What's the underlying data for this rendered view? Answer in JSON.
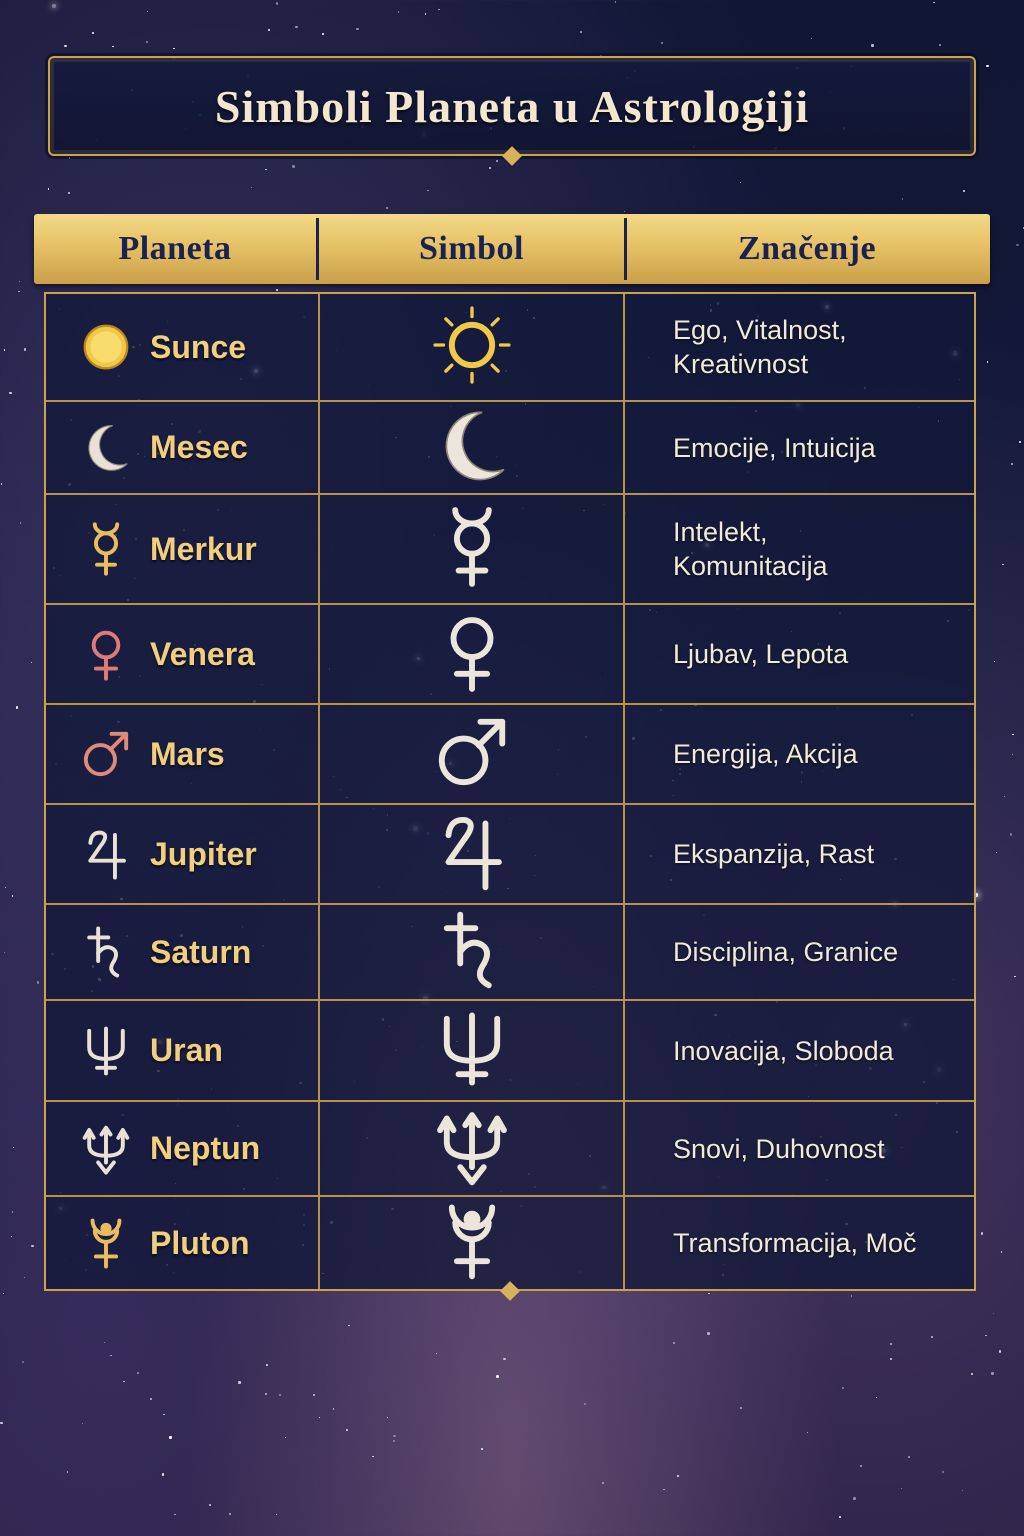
{
  "title": "Simboli Planeta u Astrologiji",
  "headers": [
    "Planeta",
    "Simbol",
    "Značenje"
  ],
  "rows": [
    {
      "name": "Sunce",
      "meaning_lines": [
        "Ego, Vitalnost,",
        "Kreativnost"
      ],
      "icon": "sun-icon",
      "color": "#f2c84a"
    },
    {
      "name": "Mesec",
      "meaning_lines": [
        "Emocije, Intuicija"
      ],
      "icon": "moon-icon",
      "color": "#e8e2d6"
    },
    {
      "name": "Merkur",
      "meaning_lines": [
        "Intelekt,",
        "Komunitacija"
      ],
      "icon": "mercury-icon",
      "color": "#e9bd5e"
    },
    {
      "name": "Venera",
      "meaning_lines": [
        "Ljubav, Lepota"
      ],
      "icon": "venus-icon",
      "color": "#e07a7a"
    },
    {
      "name": "Mars",
      "meaning_lines": [
        "Energija, Akcija"
      ],
      "icon": "mars-icon",
      "color": "#e08a7a"
    },
    {
      "name": "Jupiter",
      "meaning_lines": [
        "Ekspanzija, Rast"
      ],
      "icon": "jupiter-icon",
      "color": "#e8e2d6"
    },
    {
      "name": "Saturn",
      "meaning_lines": [
        "Disciplina, Granice"
      ],
      "icon": "saturn-icon",
      "color": "#e8e2d6"
    },
    {
      "name": "Uran",
      "meaning_lines": [
        "Inovacija, Sloboda"
      ],
      "icon": "uranus-icon",
      "color": "#e8e2d6"
    },
    {
      "name": "Neptun",
      "meaning_lines": [
        "Snovi, Duhovnost"
      ],
      "icon": "neptune-icon",
      "color": "#e8e2d6"
    },
    {
      "name": "Pluton",
      "meaning_lines": [
        "Transformacija, Moč"
      ],
      "icon": "pluto-icon",
      "color": "#e9bd5e"
    }
  ],
  "colors": {
    "gold": "#c9a24e",
    "cream": "#f3e7cf",
    "navy": "#1b2250"
  }
}
